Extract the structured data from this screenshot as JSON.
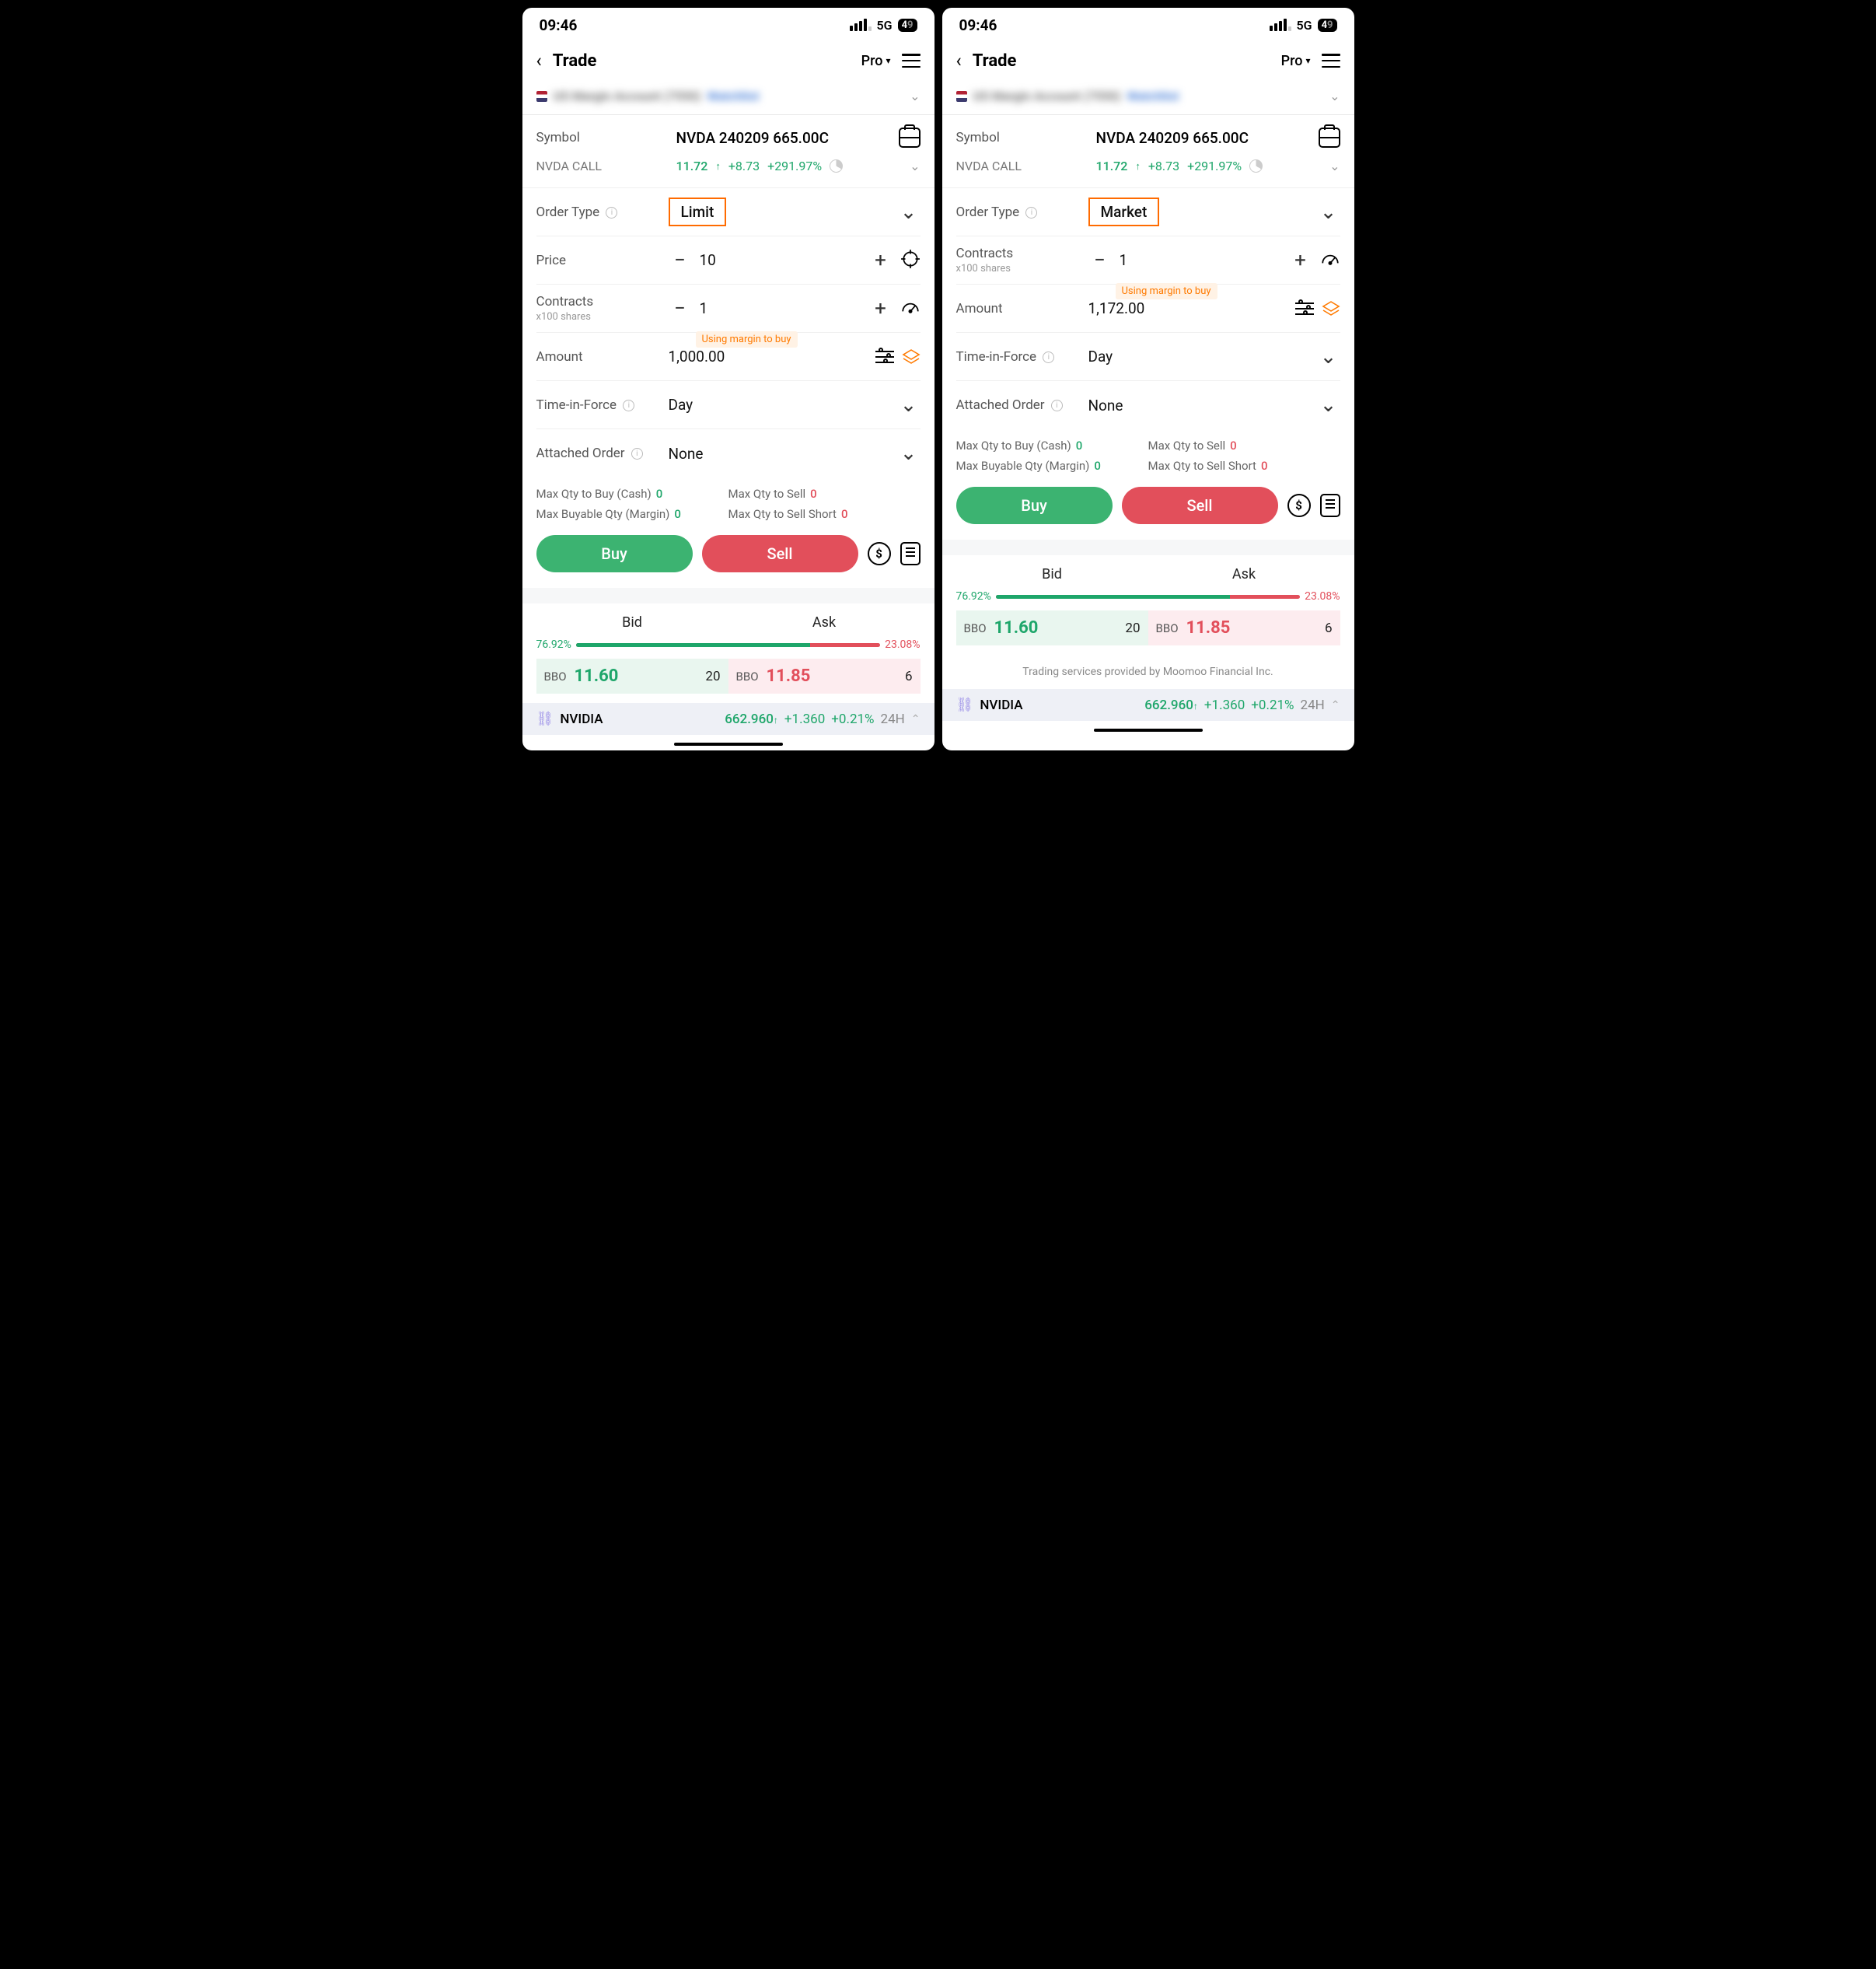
{
  "status": {
    "time": "09:46",
    "network": "5G",
    "battery": "49"
  },
  "nav": {
    "title": "Trade",
    "pro": "Pro"
  },
  "account": {
    "name": "US Margin Account (7550)",
    "tag": "Watchlist"
  },
  "symbol": {
    "label": "Symbol",
    "value": "NVDA 240209 665.00C"
  },
  "call": {
    "label": "NVDA CALL",
    "price": "11.72",
    "change": "+8.73",
    "pct": "+291.97%"
  },
  "order_type": {
    "label": "Order Type"
  },
  "price": {
    "label": "Price"
  },
  "contracts": {
    "label": "Contracts",
    "sublabel": "x100 shares"
  },
  "margin_badge": "Using margin to buy",
  "amount": {
    "label": "Amount"
  },
  "tif": {
    "label": "Time-in-Force",
    "value": "Day"
  },
  "attached": {
    "label": "Attached Order",
    "value": "None"
  },
  "qty": {
    "buy_cash_label": "Max Qty to Buy (Cash)",
    "buy_cash": "0",
    "sell_label": "Max Qty to Sell",
    "sell": "0",
    "buy_margin_label": "Max Buyable Qty (Margin)",
    "buy_margin": "0",
    "short_label": "Max Qty to Sell Short",
    "short": "0"
  },
  "buttons": {
    "buy": "Buy",
    "sell": "Sell"
  },
  "bidask": {
    "bid_label": "Bid",
    "ask_label": "Ask",
    "bid_pct": "76.92%",
    "ask_pct": "23.08%",
    "bbo": "BBO",
    "bid_price": "11.60",
    "bid_qty": "20",
    "ask_price": "11.85",
    "ask_qty": "6",
    "ratio_fill": 76.92
  },
  "ticker": {
    "name": "NVIDIA",
    "price": "662.960",
    "change": "+1.360",
    "pct": "+0.21%",
    "time": "24H"
  },
  "disclaimer": "Trading services provided by Moomoo Financial Inc.",
  "left": {
    "order_type": "Limit",
    "price": "10",
    "contracts": "1",
    "amount": "1,000.00"
  },
  "right": {
    "order_type": "Market",
    "contracts": "1",
    "amount": "1,172.00"
  }
}
